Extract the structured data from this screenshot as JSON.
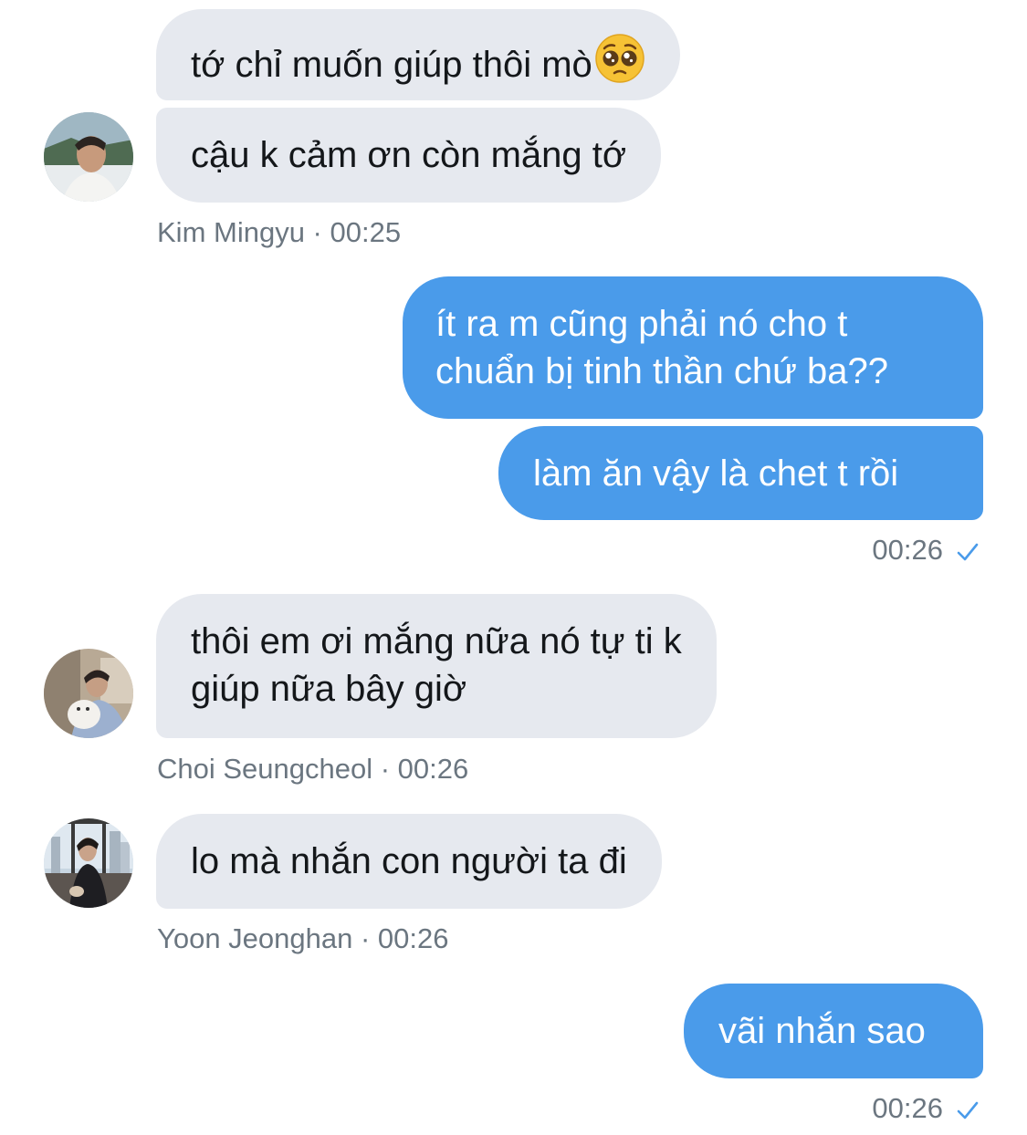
{
  "messages": [
    {
      "text": "tớ chỉ muốn giúp thôi mò",
      "emoji": "pleading-face"
    },
    {
      "text": "cậu k cảm ơn còn mắng tớ"
    },
    {
      "line1": "ít ra m cũng phải nó cho t",
      "line2": "chuẩn bị tinh thần chứ ba??"
    },
    {
      "text": "làm ăn vậy là chet t rồi"
    },
    {
      "line1": "thôi em ơi mắng nữa nó tự ti k",
      "line2": "giúp nữa bây giờ"
    },
    {
      "text": "lo mà nhắn con người ta đi"
    },
    {
      "text": "vãi nhắn sao"
    }
  ],
  "meta": {
    "kim_mingyu": "Kim Mingyu · 00:25",
    "sent_1": "00:26",
    "choi_seungcheol": "Choi Seungcheol · 00:26",
    "yoon_jeonghan": "Yoon Jeonghan · 00:26",
    "sent_2": "00:26"
  },
  "colors": {
    "incoming_bubble": "#e6e9ef",
    "outgoing_bubble": "#4a9bea",
    "meta_text": "#6b7680",
    "check": "#4a9bea"
  },
  "icons": [
    "pleading-face-emoji",
    "check-icon"
  ]
}
